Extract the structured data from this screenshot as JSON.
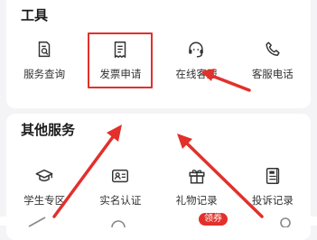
{
  "tools_section": {
    "title": "工具",
    "items": [
      {
        "label": "服务查询",
        "icon": "search-document-icon"
      },
      {
        "label": "发票申请",
        "icon": "invoice-receipt-icon"
      },
      {
        "label": "在线客服",
        "icon": "headset-icon"
      },
      {
        "label": "客服电话",
        "icon": "phone-icon"
      }
    ]
  },
  "other_section": {
    "title": "其他服务",
    "items": [
      {
        "label": "学生专区",
        "icon": "graduation-cap-icon"
      },
      {
        "label": "实名认证",
        "icon": "id-card-icon"
      },
      {
        "label": "礼物记录",
        "icon": "gift-icon"
      },
      {
        "label": "投诉记录",
        "icon": "complaint-record-icon"
      }
    ]
  },
  "bottom_nav": {
    "coupon_badge": "领券"
  },
  "colors": {
    "highlight": "#e2302b",
    "annotation_arrow": "#e2302b",
    "card_background": "#ffffff",
    "page_background": "#f4f4f6"
  }
}
